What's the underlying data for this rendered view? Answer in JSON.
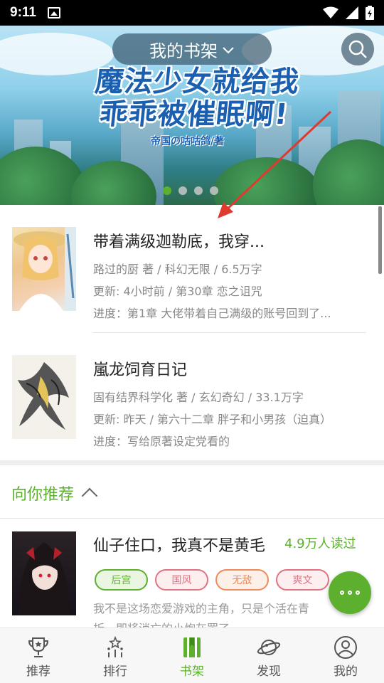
{
  "status_bar": {
    "time": "9:11"
  },
  "header": {
    "shelf_label": "我的书架",
    "banner_title_line1": "魔法少女就给我",
    "banner_title_line2": "乖乖被催眠啊!",
    "banner_author": "帝国の咕咕鸽/著"
  },
  "carousel": {
    "count": 4,
    "active": 0
  },
  "books": [
    {
      "title": "带着满级迦勒底，我穿...",
      "info": "路过的厨 著 / 科幻无限 / 6.5万字",
      "update": "更新: 4小时前 / 第30章 恋之诅咒",
      "progress": "进度：第1章 大佬带着自己满级的账号回到了..."
    },
    {
      "title": "嵐龙饲育日记",
      "info": "固有结界科学化 著 / 玄幻奇幻 / 33.1万字",
      "update": "更新: 昨天 / 第六十二章 胖子和小男孩（迫真）",
      "progress": "进度：写给原著设定党看的"
    }
  ],
  "recommend": {
    "header": "向你推荐",
    "book": {
      "title": "仙子住口，我真不是黄毛",
      "reads": "4.9万人读过",
      "tags": [
        "后宫",
        "国风",
        "无敌",
        "爽文"
      ],
      "desc_line1": "我不是这场恋爱游戏的主角，只是个活在青",
      "desc_line2": "折，即将消亡的小炮灰罢了。"
    }
  },
  "bottom_nav": [
    {
      "label": "推荐",
      "icon": "trophy-icon"
    },
    {
      "label": "排行",
      "icon": "ranking-icon"
    },
    {
      "label": "书架",
      "icon": "bookshelf-icon"
    },
    {
      "label": "发现",
      "icon": "planet-icon"
    },
    {
      "label": "我的",
      "icon": "user-icon"
    }
  ],
  "colors": {
    "accent": "#5db02e",
    "tag_green": "#5db02e",
    "tag_red": "#e0737f",
    "tag_orange": "#ef8a5a",
    "tag_pink": "#e0737f"
  }
}
